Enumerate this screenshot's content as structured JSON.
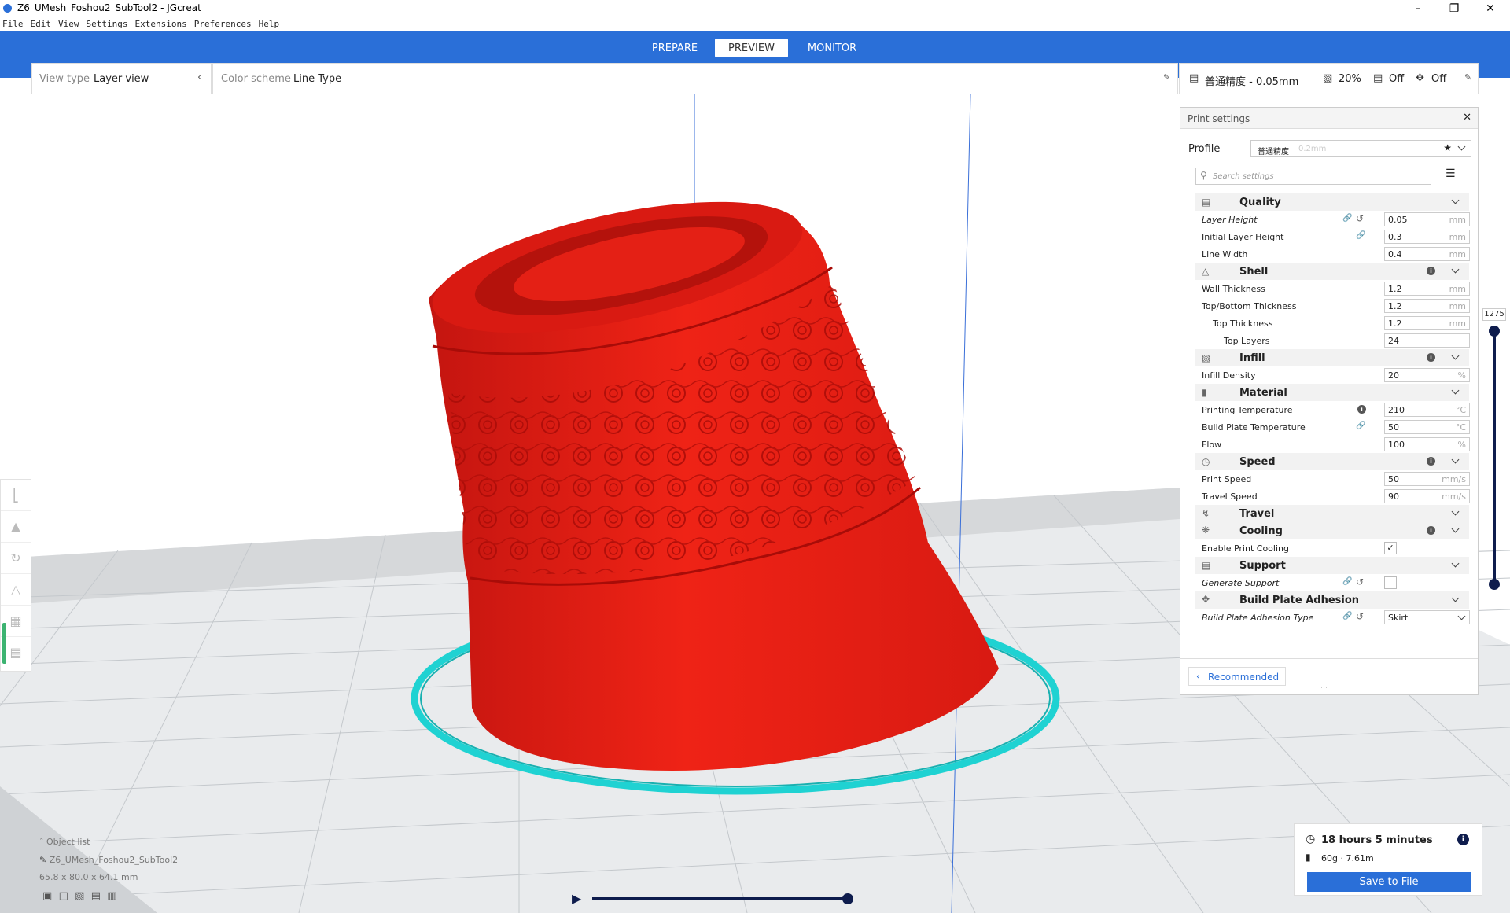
{
  "window": {
    "title": "Z6_UMesh_Foshou2_SubTool2 - JGcreat"
  },
  "menu": [
    "File",
    "Edit",
    "View",
    "Settings",
    "Extensions",
    "Preferences",
    "Help"
  ],
  "stages": {
    "prepare": "PREPARE",
    "preview": "PREVIEW",
    "monitor": "MONITOR"
  },
  "view_panel": {
    "label": "View type",
    "value": "Layer view"
  },
  "color_panel": {
    "label": "Color scheme",
    "value": "Line Type"
  },
  "quick": {
    "profile": "普通精度 - 0.05mm",
    "infill": "20%",
    "support": "Off",
    "adhesion": "Off"
  },
  "print_settings": {
    "title": "Print settings",
    "profile_label": "Profile",
    "profile_value": "普通精度",
    "profile_hint": "0.2mm",
    "search_placeholder": "Search settings",
    "recommended": "Recommended",
    "categories": {
      "quality": "Quality",
      "shell": "Shell",
      "infill": "Infill",
      "material": "Material",
      "speed": "Speed",
      "travel": "Travel",
      "cooling": "Cooling",
      "support": "Support",
      "adhesion": "Build Plate Adhesion"
    },
    "settings": {
      "layer_height": {
        "name": "Layer Height",
        "value": "0.05",
        "unit": "mm"
      },
      "initial_layer_height": {
        "name": "Initial Layer Height",
        "value": "0.3",
        "unit": "mm"
      },
      "line_width": {
        "name": "Line Width",
        "value": "0.4",
        "unit": "mm"
      },
      "wall_thickness": {
        "name": "Wall Thickness",
        "value": "1.2",
        "unit": "mm"
      },
      "top_bottom_thickness": {
        "name": "Top/Bottom Thickness",
        "value": "1.2",
        "unit": "mm"
      },
      "top_thickness": {
        "name": "Top Thickness",
        "value": "1.2",
        "unit": "mm"
      },
      "top_layers": {
        "name": "Top Layers",
        "value": "24"
      },
      "infill_density": {
        "name": "Infill Density",
        "value": "20",
        "unit": "%"
      },
      "printing_temperature": {
        "name": "Printing Temperature",
        "value": "210",
        "unit": "°C"
      },
      "build_plate_temperature": {
        "name": "Build Plate Temperature",
        "value": "50",
        "unit": "°C"
      },
      "flow": {
        "name": "Flow",
        "value": "100",
        "unit": "%"
      },
      "print_speed": {
        "name": "Print Speed",
        "value": "50",
        "unit": "mm/s"
      },
      "travel_speed": {
        "name": "Travel Speed",
        "value": "90",
        "unit": "mm/s"
      },
      "enable_print_cooling": {
        "name": "Enable Print Cooling",
        "checked": true
      },
      "generate_support": {
        "name": "Generate Support",
        "checked": false
      },
      "build_plate_adhesion_type": {
        "name": "Build Plate Adhesion Type",
        "value": "Skirt"
      }
    }
  },
  "layer_slider": {
    "value": "1275"
  },
  "object_list": {
    "title": "Object list",
    "name": "Z6_UMesh_Foshou2_SubTool2",
    "dimensions": "65.8 x 80.0 x 64.1 mm"
  },
  "estimate": {
    "time": "18 hours 5 minutes",
    "material": "60g · 7.61m",
    "save_label": "Save to File"
  },
  "colors": {
    "accent": "#2a6fd8",
    "model": "#e81a12",
    "skirt": "#1fd2d2",
    "slider": "#0e1c4d"
  }
}
